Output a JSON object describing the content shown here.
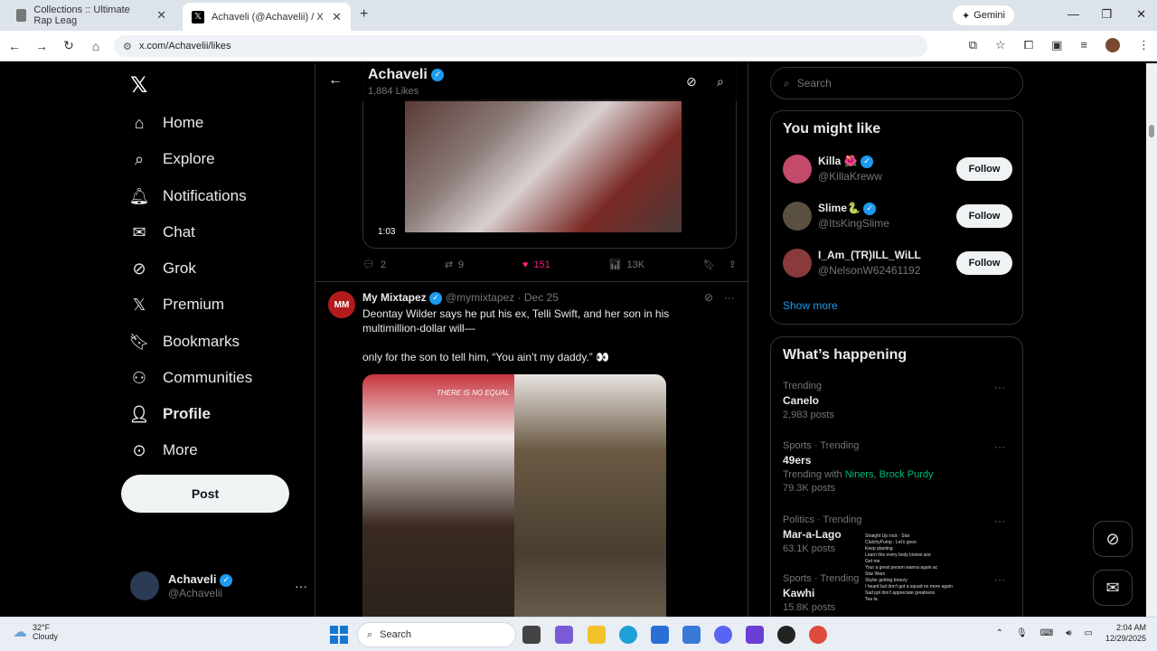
{
  "browser": {
    "tabs": [
      {
        "title": "Collections :: Ultimate Rap Leag",
        "active": false
      },
      {
        "title": "Achaveli (@Achavelii) / X",
        "active": true
      }
    ],
    "gemini_label": "Gemini",
    "url": "x.com/Achavelii/likes"
  },
  "sidebar": {
    "items": [
      {
        "label": "Home",
        "icon": "home-icon"
      },
      {
        "label": "Explore",
        "icon": "search-icon"
      },
      {
        "label": "Notifications",
        "icon": "bell-icon"
      },
      {
        "label": "Chat",
        "icon": "mail-icon"
      },
      {
        "label": "Grok",
        "icon": "grok-icon"
      },
      {
        "label": "Premium",
        "icon": "x-icon"
      },
      {
        "label": "Bookmarks",
        "icon": "bookmark-icon"
      },
      {
        "label": "Communities",
        "icon": "people-icon"
      },
      {
        "label": "Profile",
        "icon": "person-icon"
      },
      {
        "label": "More",
        "icon": "more-circle-icon"
      }
    ],
    "post_label": "Post",
    "account": {
      "name": "Achaveli",
      "handle": "@Achavelii"
    }
  },
  "main": {
    "header": {
      "title": "Achaveli",
      "subtitle": "1,884 Likes"
    },
    "video": {
      "duration": "1:03"
    },
    "video_actions": {
      "replies": "2",
      "reposts": "9",
      "likes": "151",
      "views": "13K"
    },
    "tweet": {
      "author": "My Mixtapez",
      "avatar_text": "MM",
      "handle_date": "@mymixtapez · Dec 25",
      "text_line1": "Deontay Wilder says he put his ex, Telli Swift, and her son in his multimillion-dollar will—",
      "text_line2": "only for the son to tell him, “You ain’t my daddy.” 👀",
      "image_tag": "THERE IS NO EQUAL"
    }
  },
  "right": {
    "search_placeholder": "Search",
    "you_might_like": {
      "title": "You might like",
      "users": [
        {
          "name": "Killa 🌺",
          "handle": "@KillaKreww",
          "follow": "Follow"
        },
        {
          "name": "Slime🐍",
          "handle": "@ItsKingSlime",
          "follow": "Follow"
        },
        {
          "name": "I_Am_(TR)ILL_WiLL",
          "handle": "@NelsonW62461192",
          "follow": "Follow"
        }
      ],
      "show_more": "Show more"
    },
    "happening": {
      "title": "What’s happening",
      "trends": [
        {
          "category": "Trending",
          "title": "Canelo",
          "count": "2,983 posts"
        },
        {
          "category": "Sports · Trending",
          "title": "49ers",
          "with_label": "Trending with",
          "with_links": "Niners, Brock Purdy",
          "count": "79.3K posts"
        },
        {
          "category": "Politics · Trending",
          "title": "Mar-a-Lago",
          "count": "63.1K posts"
        },
        {
          "category": "Sports · Trending",
          "title": "Kawhi",
          "count": "15.8K posts"
        }
      ]
    }
  },
  "chat_overlay": [
    "Straight Up rock · Star",
    "ClutchyPump : Let's gooo",
    "Keep planting",
    "Learn this every body knows ace",
    "Get me",
    "Your a great person wanna again ac",
    "Star Wars",
    "Skyler getting breezy",
    "I heard but don't got a squad no more again",
    "Sad ppl don't appreciate greatness",
    "Tea ta"
  ],
  "taskbar": {
    "weather_temp": "32°F",
    "weather_desc": "Cloudy",
    "search_label": "Search",
    "time": "2:04 AM",
    "date": "12/29/2025"
  }
}
